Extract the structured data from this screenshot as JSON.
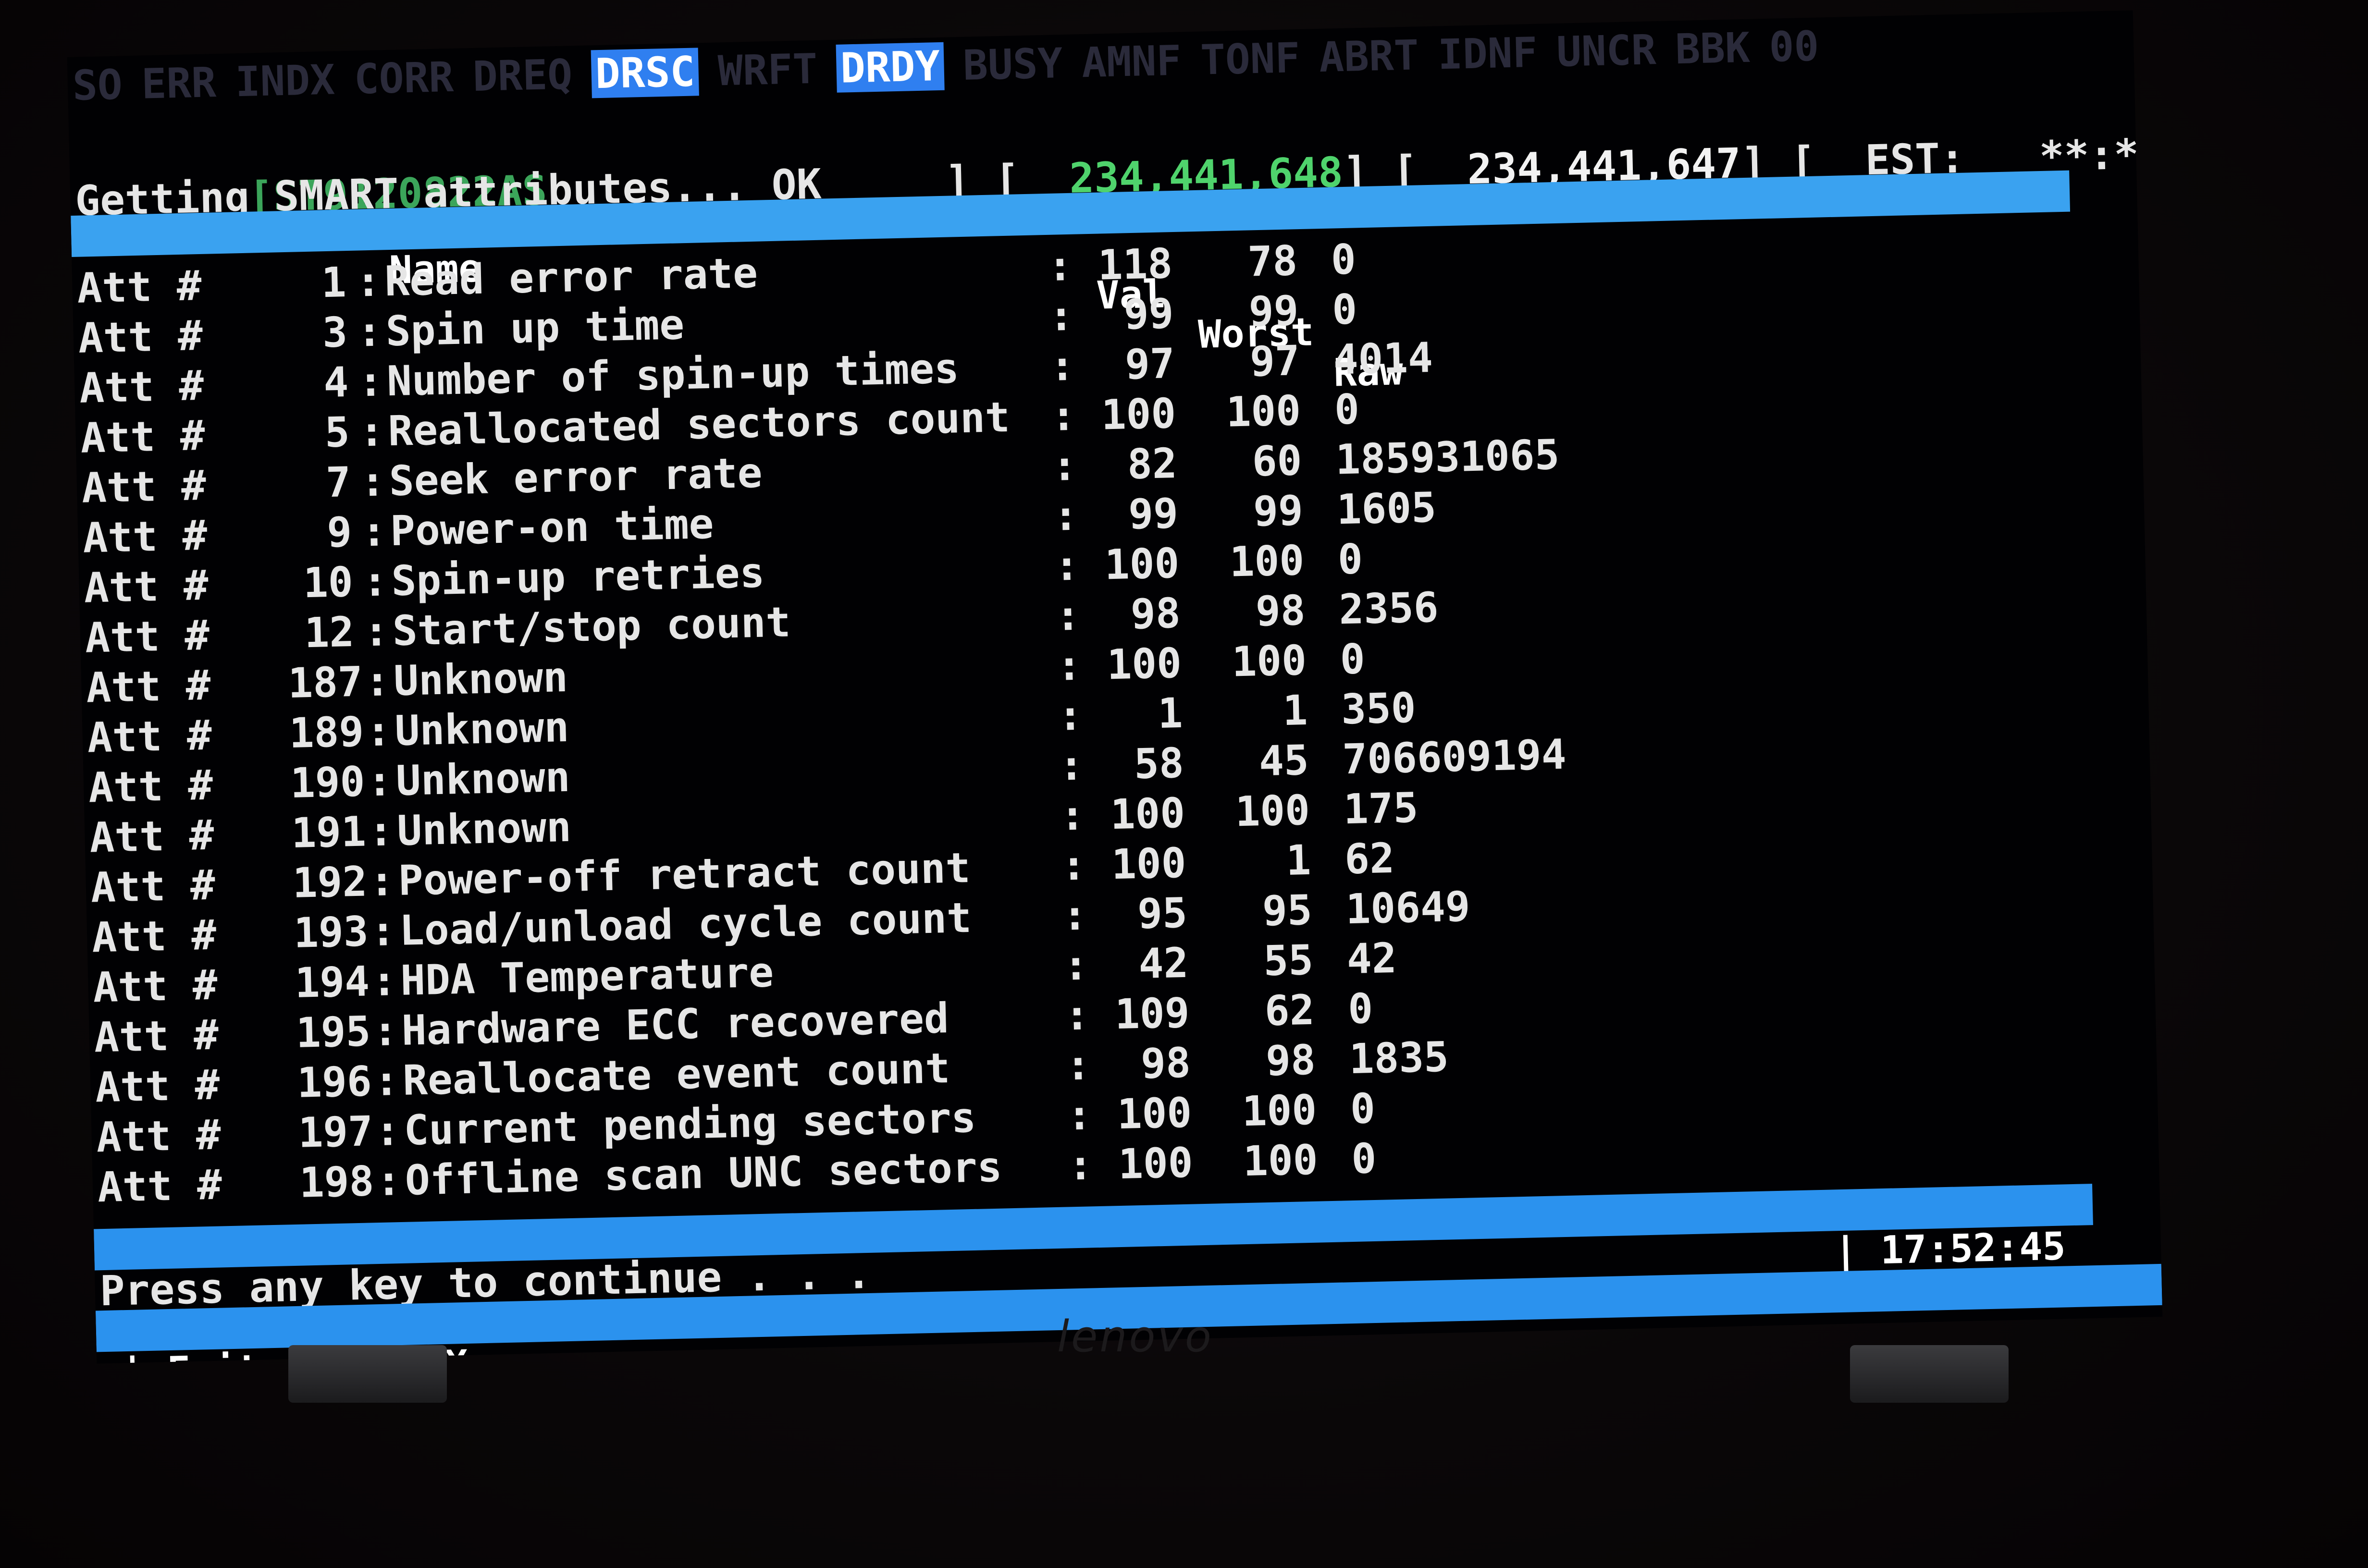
{
  "status_flags": [
    {
      "label": "SO",
      "active": false
    },
    {
      "label": "ERR",
      "active": false
    },
    {
      "label": "INDX",
      "active": false
    },
    {
      "label": "CORR",
      "active": false
    },
    {
      "label": "DREQ",
      "active": false
    },
    {
      "label": "DRSC",
      "active": true
    },
    {
      "label": "WRFT",
      "active": false
    },
    {
      "label": "DRDY",
      "active": true
    },
    {
      "label": "BUSY",
      "active": false
    },
    {
      "label": "AMNF",
      "active": false
    },
    {
      "label": "TONF",
      "active": false
    },
    {
      "label": "ABRT",
      "active": false
    },
    {
      "label": "IDNF",
      "active": false
    },
    {
      "label": "UNCR",
      "active": false
    },
    {
      "label": "BBK",
      "active": false
    },
    {
      "label": "00",
      "active": false
    }
  ],
  "drive": {
    "model": "[ST9120822AS",
    "lba_total": "234,441,648",
    "lba_max": "234,441,647",
    "est_label": "EST:",
    "est_value": "**:**:**"
  },
  "status_message": "Getting SMART attributes... OK",
  "table": {
    "headers": {
      "name": "Name",
      "val": "Val",
      "worst": "Worst",
      "raw": "Raw"
    },
    "att_prefix": "Att #",
    "rows": [
      {
        "num": "1",
        "name": "Read error rate",
        "val": "118",
        "worst": "78",
        "raw": "0"
      },
      {
        "num": "3",
        "name": "Spin up time",
        "val": "99",
        "worst": "99",
        "raw": "0"
      },
      {
        "num": "4",
        "name": "Number of spin-up times",
        "val": "97",
        "worst": "97",
        "raw": "4014"
      },
      {
        "num": "5",
        "name": "Reallocated sectors count",
        "val": "100",
        "worst": "100",
        "raw": "0"
      },
      {
        "num": "7",
        "name": "Seek error rate",
        "val": "82",
        "worst": "60",
        "raw": "185931065"
      },
      {
        "num": "9",
        "name": "Power-on time",
        "val": "99",
        "worst": "99",
        "raw": "1605"
      },
      {
        "num": "10",
        "name": "Spin-up retries",
        "val": "100",
        "worst": "100",
        "raw": "0"
      },
      {
        "num": "12",
        "name": "Start/stop count",
        "val": "98",
        "worst": "98",
        "raw": "2356"
      },
      {
        "num": "187",
        "name": "Unknown",
        "val": "100",
        "worst": "100",
        "raw": "0"
      },
      {
        "num": "189",
        "name": "Unknown",
        "val": "1",
        "worst": "1",
        "raw": "350"
      },
      {
        "num": "190",
        "name": "Unknown",
        "val": "58",
        "worst": "45",
        "raw": "706609194"
      },
      {
        "num": "191",
        "name": "Unknown",
        "val": "100",
        "worst": "100",
        "raw": "175"
      },
      {
        "num": "192",
        "name": "Power-off retract count",
        "val": "100",
        "worst": "1",
        "raw": "62"
      },
      {
        "num": "193",
        "name": "Load/unload cycle count",
        "val": "95",
        "worst": "95",
        "raw": "10649"
      },
      {
        "num": "194",
        "name": "HDA Temperature",
        "val": "42",
        "worst": "55",
        "raw": "42"
      },
      {
        "num": "195",
        "name": "Hardware ECC recovered",
        "val": "109",
        "worst": "62",
        "raw": "0"
      },
      {
        "num": "196",
        "name": "Reallocate event count",
        "val": "98",
        "worst": "98",
        "raw": "1835"
      },
      {
        "num": "197",
        "name": "Current pending sectors",
        "val": "100",
        "worst": "100",
        "raw": "0"
      },
      {
        "num": "198",
        "name": "Offline scan UNC sectors",
        "val": "100",
        "worst": "100",
        "raw": "0"
      }
    ]
  },
  "clock": "| 17:52:45",
  "prompt": "Press any key to continue . . .",
  "exit_hint": "| Exit : <ALT+X>",
  "logo_text": "lenovo",
  "colors": {
    "bar_blue": "#3aa2f0",
    "flag_active_bg": "#2f7ff0",
    "lba_green": "#4fd36c",
    "text": "#e6e6e6"
  }
}
